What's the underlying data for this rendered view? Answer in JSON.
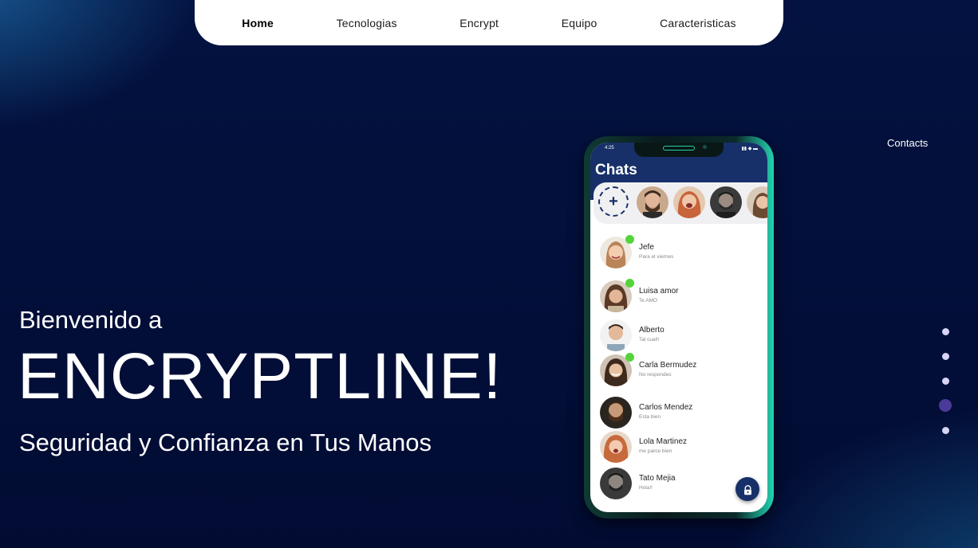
{
  "nav": {
    "items": [
      {
        "label": "Home",
        "active": true
      },
      {
        "label": "Tecnologias"
      },
      {
        "label": "Encrypt"
      },
      {
        "label": "Equipo"
      },
      {
        "label": "Caracteristicas"
      }
    ]
  },
  "contacts_link": "Contacts",
  "hero": {
    "pre_title": "Bienvenido a",
    "title": "ENCRYPTLINE!",
    "subtitle": "Seguridad y Confianza en Tus Manos"
  },
  "slider_dots": {
    "count": 5,
    "active_index": 4
  },
  "phone": {
    "status_time": "4:25",
    "status_icons": "▮▮ ◆ ▬",
    "header_title": "Chats",
    "add_story_symbol": "+",
    "lock_icon": "lock-icon",
    "chats": [
      {
        "name": "Jefe",
        "message": "Para el viernes",
        "online": true
      },
      {
        "name": "Luisa amor",
        "message": "Te AMO",
        "online": true
      },
      {
        "name": "Alberto",
        "message": "Tal cual!!",
        "online": false
      },
      {
        "name": "Carla Bermudez",
        "message": "No respondes",
        "online": true
      },
      {
        "name": "Carlos Mendez",
        "message": "Esta bien",
        "online": false
      },
      {
        "name": "Lola Martinez",
        "message": "me parce bien",
        "online": false
      },
      {
        "name": "Tato Mejia",
        "message": "Hola!!",
        "online": false
      }
    ]
  },
  "colors": {
    "background": "#030d38",
    "phone_header": "#173069",
    "online": "#55d43a",
    "accent_dot": "#4a3a9a"
  }
}
